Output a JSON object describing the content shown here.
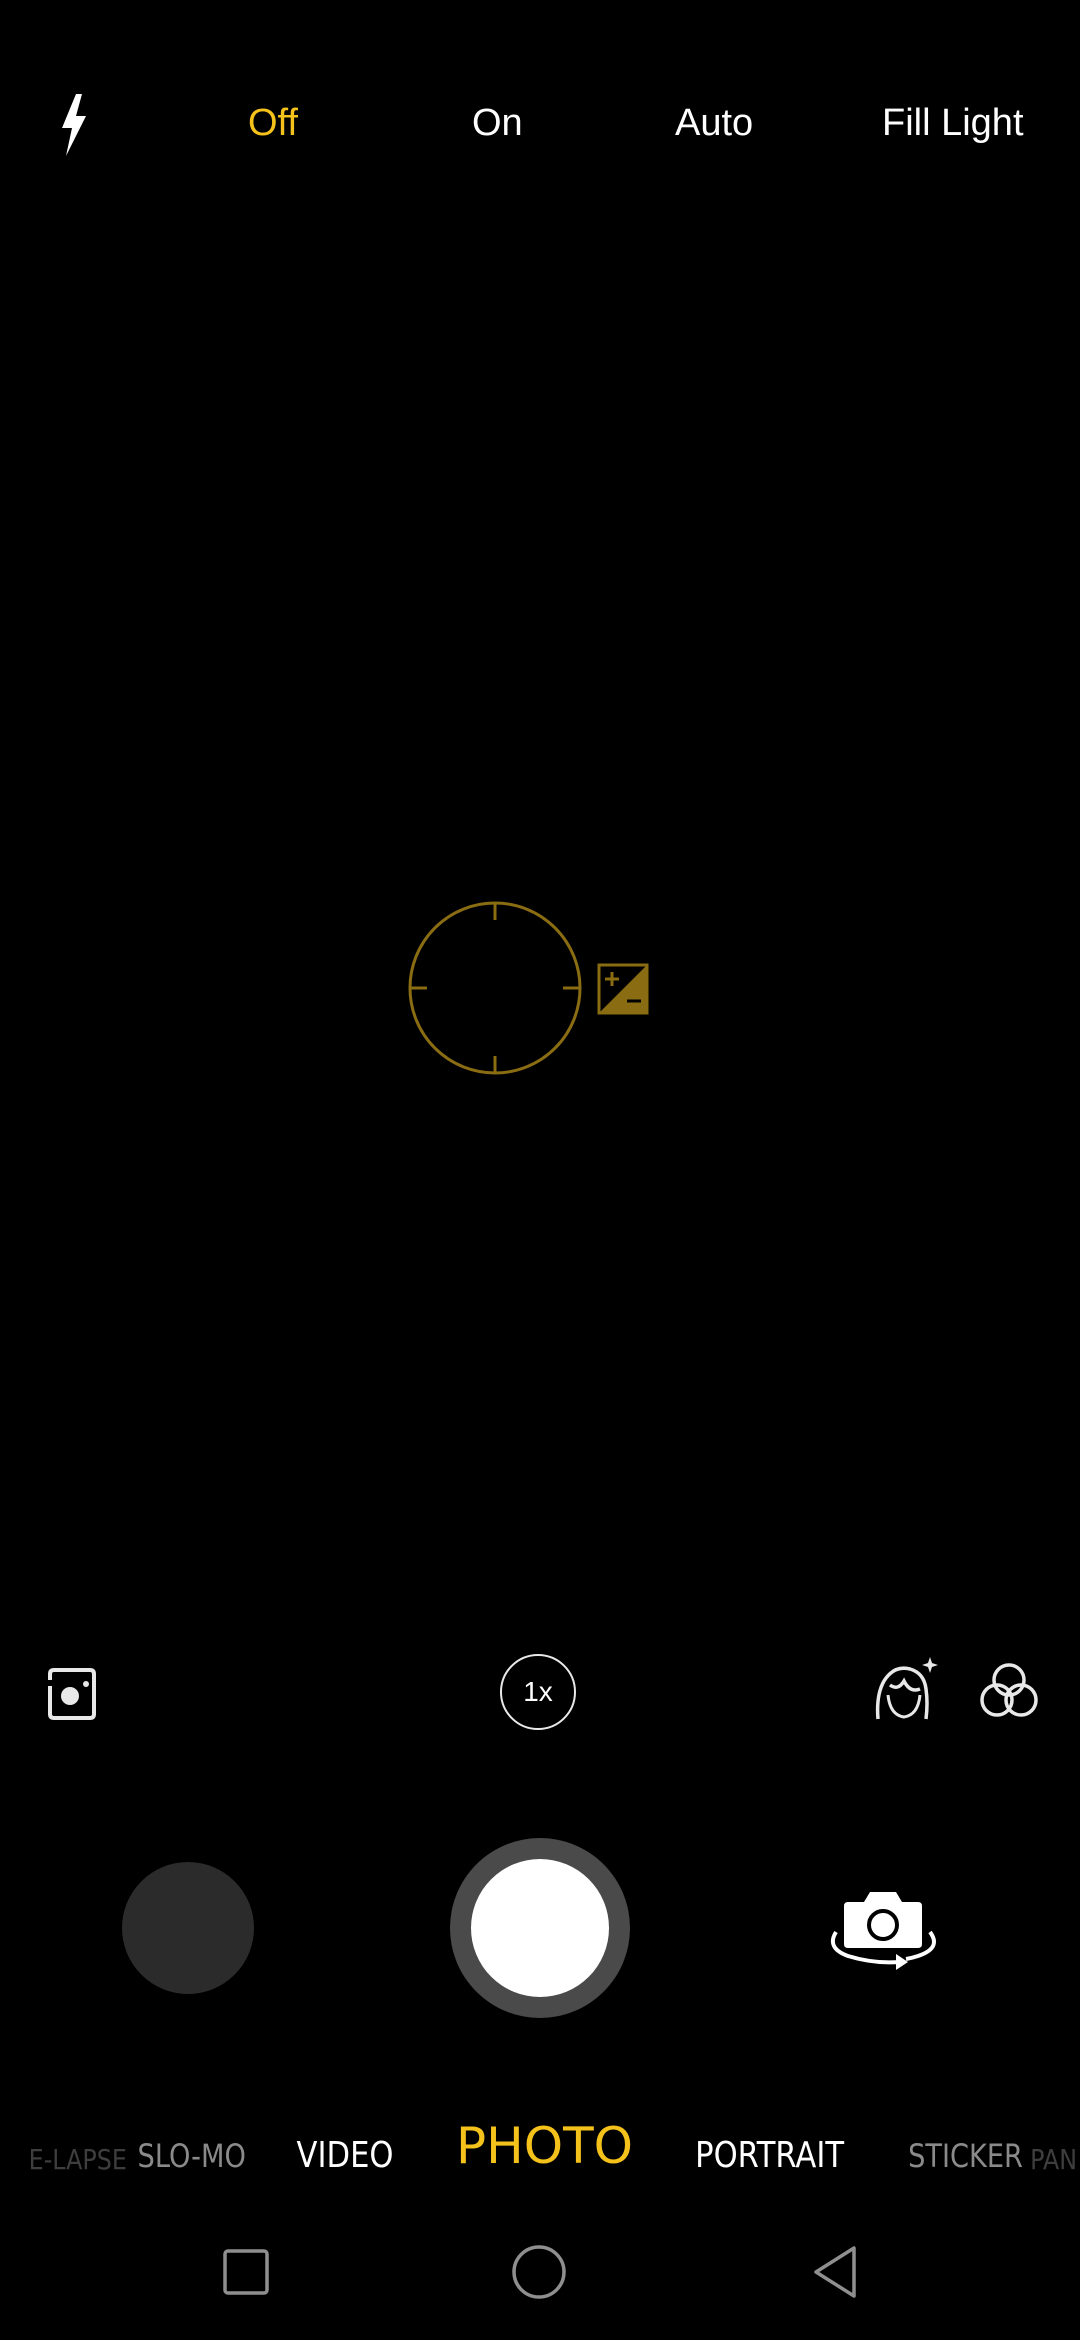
{
  "flash": {
    "icon": "flash-bolt-icon",
    "options": [
      {
        "label": "Off",
        "selected": true
      },
      {
        "label": "On",
        "selected": false
      },
      {
        "label": "Auto",
        "selected": false
      },
      {
        "label": "Fill Light",
        "selected": false
      }
    ]
  },
  "viewfinder": {
    "focus_icon": "focus-reticle-icon",
    "exposure_icon": "exposure-compensation-icon"
  },
  "controls": {
    "ai_icon": "ai-scene-icon",
    "zoom_label": "1x",
    "beauty_icon": "beauty-face-icon",
    "filter_icon": "color-filter-icon"
  },
  "capture": {
    "gallery": "gallery-thumbnail",
    "shutter": "shutter-button",
    "switch_icon": "switch-camera-icon"
  },
  "modes": {
    "items": [
      "TIME-LAPSE",
      "SLO-MO",
      "VIDEO",
      "PHOTO",
      "PORTRAIT",
      "STICKER",
      "PANO"
    ],
    "visible_text": [
      "E-LAPSE",
      "SLO-MO",
      "VIDEO",
      "PHOTO",
      "PORTRAIT",
      "STICKER",
      "PAN"
    ],
    "selected": "PHOTO"
  },
  "nav": {
    "recents_icon": "square-recents-icon",
    "home_icon": "circle-home-icon",
    "back_icon": "triangle-back-icon"
  },
  "colors": {
    "accent": "#f5c21b",
    "background": "#000000",
    "reticle": "#8a6d12"
  }
}
